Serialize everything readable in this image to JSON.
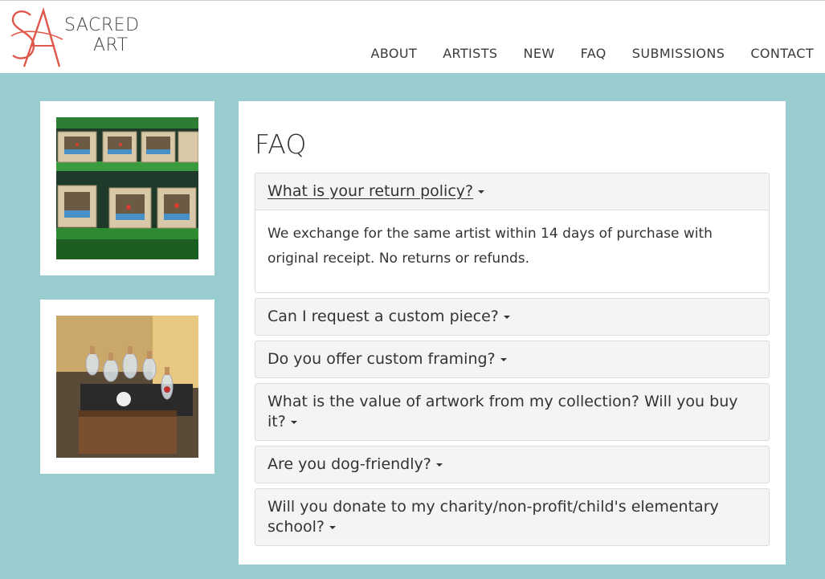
{
  "brand": {
    "line1": "SACRED",
    "line2": "ART",
    "monogram": "SA",
    "accent": "#e0584b"
  },
  "nav": [
    {
      "label": "ABOUT"
    },
    {
      "label": "ARTISTS"
    },
    {
      "label": "NEW"
    },
    {
      "label": "FAQ"
    },
    {
      "label": "SUBMISSIONS"
    },
    {
      "label": "CONTACT"
    }
  ],
  "page": {
    "title": "FAQ",
    "background": "#99cccf"
  },
  "faq": [
    {
      "question": "What is your return policy?",
      "open": true,
      "answer": "We exchange for the same artist within 14 days of purchase with original receipt. No returns or refunds."
    },
    {
      "question": "Can I request a custom piece?",
      "open": false
    },
    {
      "question": "Do you offer custom framing?",
      "open": false
    },
    {
      "question": "What is the value of artwork from my collection? Will you buy it?",
      "open": false
    },
    {
      "question": "Are you dog-friendly?",
      "open": false
    },
    {
      "question": "Will you donate to my charity/non-profit/child's elementary school?",
      "open": false
    }
  ]
}
